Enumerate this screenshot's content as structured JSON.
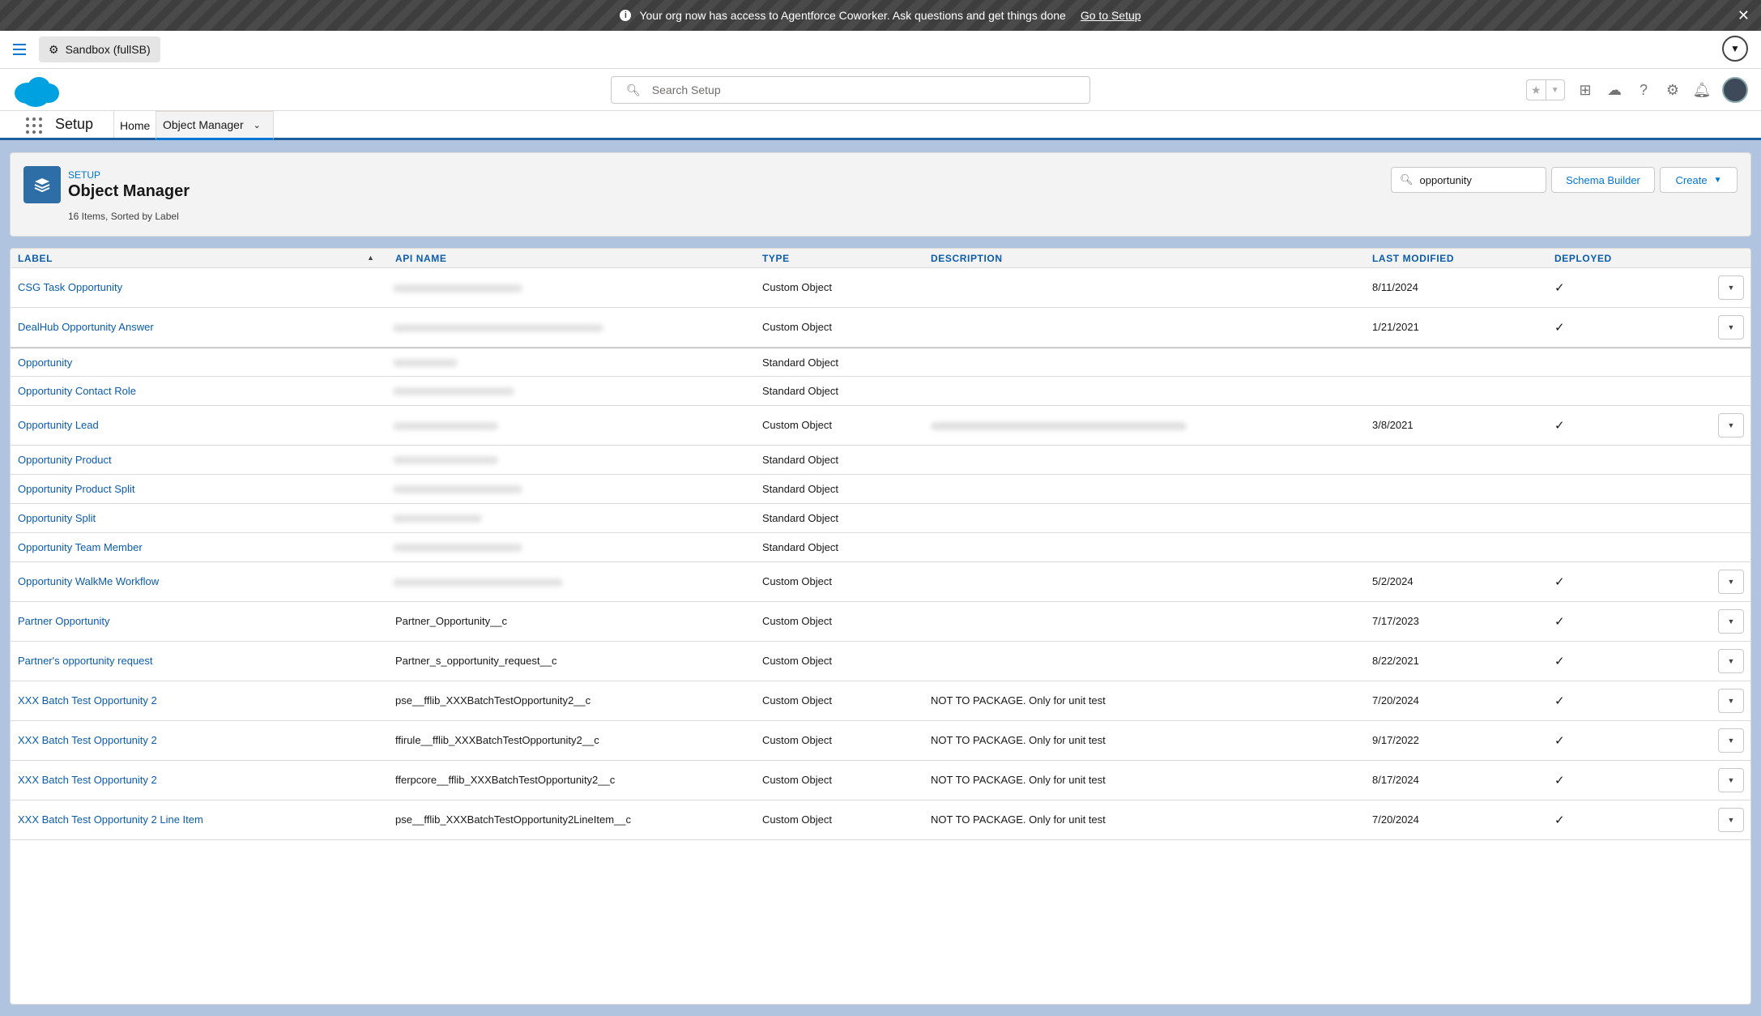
{
  "banner": {
    "message": "Your org now has access to Agentforce Coworker. Ask questions and get things done",
    "link": "Go to Setup"
  },
  "sandbox": {
    "label": "Sandbox (fullSB)"
  },
  "search": {
    "placeholder": "Search Setup"
  },
  "app": {
    "name": "Setup",
    "nav_home": "Home",
    "nav_tab": "Object Manager"
  },
  "page": {
    "breadcrumb": "SETUP",
    "title": "Object Manager",
    "subtitle": "16 Items, Sorted by Label",
    "quickfind_value": "opportunity",
    "schema_builder": "Schema Builder",
    "create": "Create"
  },
  "table": {
    "headers": {
      "label": "LABEL",
      "api": "API NAME",
      "type": "TYPE",
      "description": "DESCRIPTION",
      "modified": "LAST MODIFIED",
      "deployed": "DEPLOYED"
    },
    "rows": [
      {
        "label": "CSG Task Opportunity",
        "api": "",
        "type": "Custom Object",
        "description": "",
        "modified": "8/11/2024",
        "deployed": "✓"
      },
      {
        "label": "DealHub Opportunity Answer",
        "api": "",
        "type": "Custom Object",
        "description": "",
        "modified": "1/21/2021",
        "deployed": "✓"
      },
      {
        "label": "Opportunity",
        "api": "",
        "type": "Standard Object",
        "description": "",
        "modified": "",
        "deployed": ""
      },
      {
        "label": "Opportunity Contact Role",
        "api": "",
        "type": "Standard Object",
        "description": "",
        "modified": "",
        "deployed": ""
      },
      {
        "label": "Opportunity Lead",
        "api": "",
        "type": "Custom Object",
        "description": "",
        "modified": "3/8/2021",
        "deployed": "✓"
      },
      {
        "label": "Opportunity Product",
        "api": "",
        "type": "Standard Object",
        "description": "",
        "modified": "",
        "deployed": ""
      },
      {
        "label": "Opportunity Product Split",
        "api": "",
        "type": "Standard Object",
        "description": "",
        "modified": "",
        "deployed": ""
      },
      {
        "label": "Opportunity Split",
        "api": "",
        "type": "Standard Object",
        "description": "",
        "modified": "",
        "deployed": ""
      },
      {
        "label": "Opportunity Team Member",
        "api": "",
        "type": "Standard Object",
        "description": "",
        "modified": "",
        "deployed": ""
      },
      {
        "label": "Opportunity WalkMe Workflow",
        "api": "",
        "type": "Custom Object",
        "description": "",
        "modified": "5/2/2024",
        "deployed": "✓"
      },
      {
        "label": "Partner Opportunity",
        "api": "Partner_Opportunity__c",
        "type": "Custom Object",
        "description": "",
        "modified": "7/17/2023",
        "deployed": "✓"
      },
      {
        "label": "Partner's opportunity request",
        "api": "Partner_s_opportunity_request__c",
        "type": "Custom Object",
        "description": "",
        "modified": "8/22/2021",
        "deployed": "✓"
      },
      {
        "label": "XXX Batch Test Opportunity 2",
        "api": "pse__fflib_XXXBatchTestOpportunity2__c",
        "type": "Custom Object",
        "description": "NOT TO PACKAGE. Only for unit test",
        "modified": "7/20/2024",
        "deployed": "✓"
      },
      {
        "label": "XXX Batch Test Opportunity 2",
        "api": "ffirule__fflib_XXXBatchTestOpportunity2__c",
        "type": "Custom Object",
        "description": "NOT TO PACKAGE. Only for unit test",
        "modified": "9/17/2022",
        "deployed": "✓"
      },
      {
        "label": "XXX Batch Test Opportunity 2",
        "api": "fferpcore__fflib_XXXBatchTestOpportunity2__c",
        "type": "Custom Object",
        "description": "NOT TO PACKAGE. Only for unit test",
        "modified": "8/17/2024",
        "deployed": "✓"
      },
      {
        "label": "XXX Batch Test Opportunity 2 Line Item",
        "api": "pse__fflib_XXXBatchTestOpportunity2LineItem__c",
        "type": "Custom Object",
        "description": "NOT TO PACKAGE. Only for unit test",
        "modified": "7/20/2024",
        "deployed": "✓"
      }
    ]
  },
  "colors": {
    "brand": "#0176d3",
    "link": "#0b5cab",
    "header_bar": "#1b5f9e"
  }
}
